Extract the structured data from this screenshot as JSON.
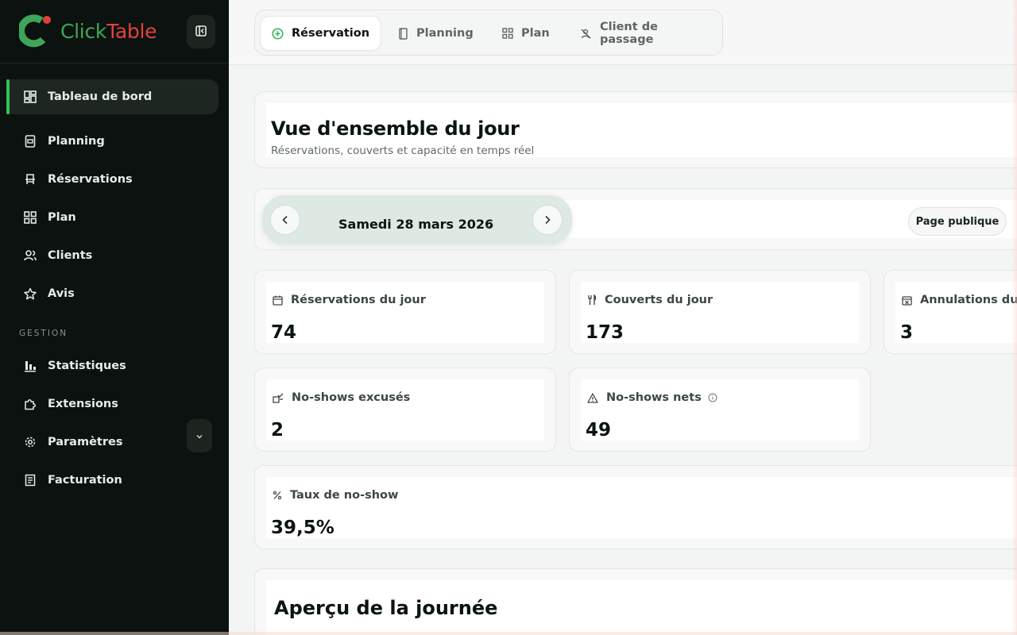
{
  "app": {
    "logo_part1": "Click",
    "logo_part2": "Table",
    "brand_green": "#3fa659",
    "brand_red": "#e2413b"
  },
  "sidebar": {
    "items": [
      {
        "label": "Tableau de bord",
        "icon": "dashboard-icon",
        "active": true
      },
      {
        "label": "Planning",
        "icon": "calendar-book-icon"
      },
      {
        "label": "Réservations",
        "icon": "chair-icon"
      },
      {
        "label": "Plan",
        "icon": "grid-icon"
      },
      {
        "label": "Clients",
        "icon": "users-icon"
      },
      {
        "label": "Avis",
        "icon": "star-icon"
      }
    ],
    "section_label": "GESTION",
    "gestion_items": [
      {
        "label": "Statistiques",
        "icon": "bar-chart-icon"
      },
      {
        "label": "Extensions",
        "icon": "puzzle-icon"
      },
      {
        "label": "Paramètres",
        "icon": "gear-icon"
      },
      {
        "label": "Facturation",
        "icon": "receipt-icon"
      }
    ]
  },
  "tabs": [
    {
      "label": "Réservation",
      "icon": "plus-circle-icon",
      "active": true
    },
    {
      "label": "Planning",
      "icon": "bookmark-icon"
    },
    {
      "label": "Plan",
      "icon": "grid-icon"
    },
    {
      "label": "Client de passage",
      "icon": "walk-in-icon"
    }
  ],
  "overview": {
    "title": "Vue d'ensemble du jour",
    "subtitle": "Réservations, couverts et capacité en temps réel"
  },
  "date_nav": {
    "date": "Samedi 28 mars 2026",
    "public_page": "Page publique"
  },
  "stats": [
    {
      "label": "Réservations du jour",
      "value": "74",
      "icon": "calendar-icon"
    },
    {
      "label": "Couverts du jour",
      "value": "173",
      "icon": "cutlery-icon"
    },
    {
      "label": "Annulations du jo",
      "value": "3",
      "icon": "calendar-x-icon"
    },
    {
      "label": "No-shows excusés",
      "value": "2",
      "icon": "no-show-excused-icon"
    },
    {
      "label": "No-shows nets",
      "value": "49",
      "icon": "warning-icon"
    },
    {
      "label": "Taux de no-show",
      "value": "39,5%",
      "icon": "percent-icon"
    }
  ],
  "day_overview": {
    "title": "Aperçu de la journée"
  }
}
